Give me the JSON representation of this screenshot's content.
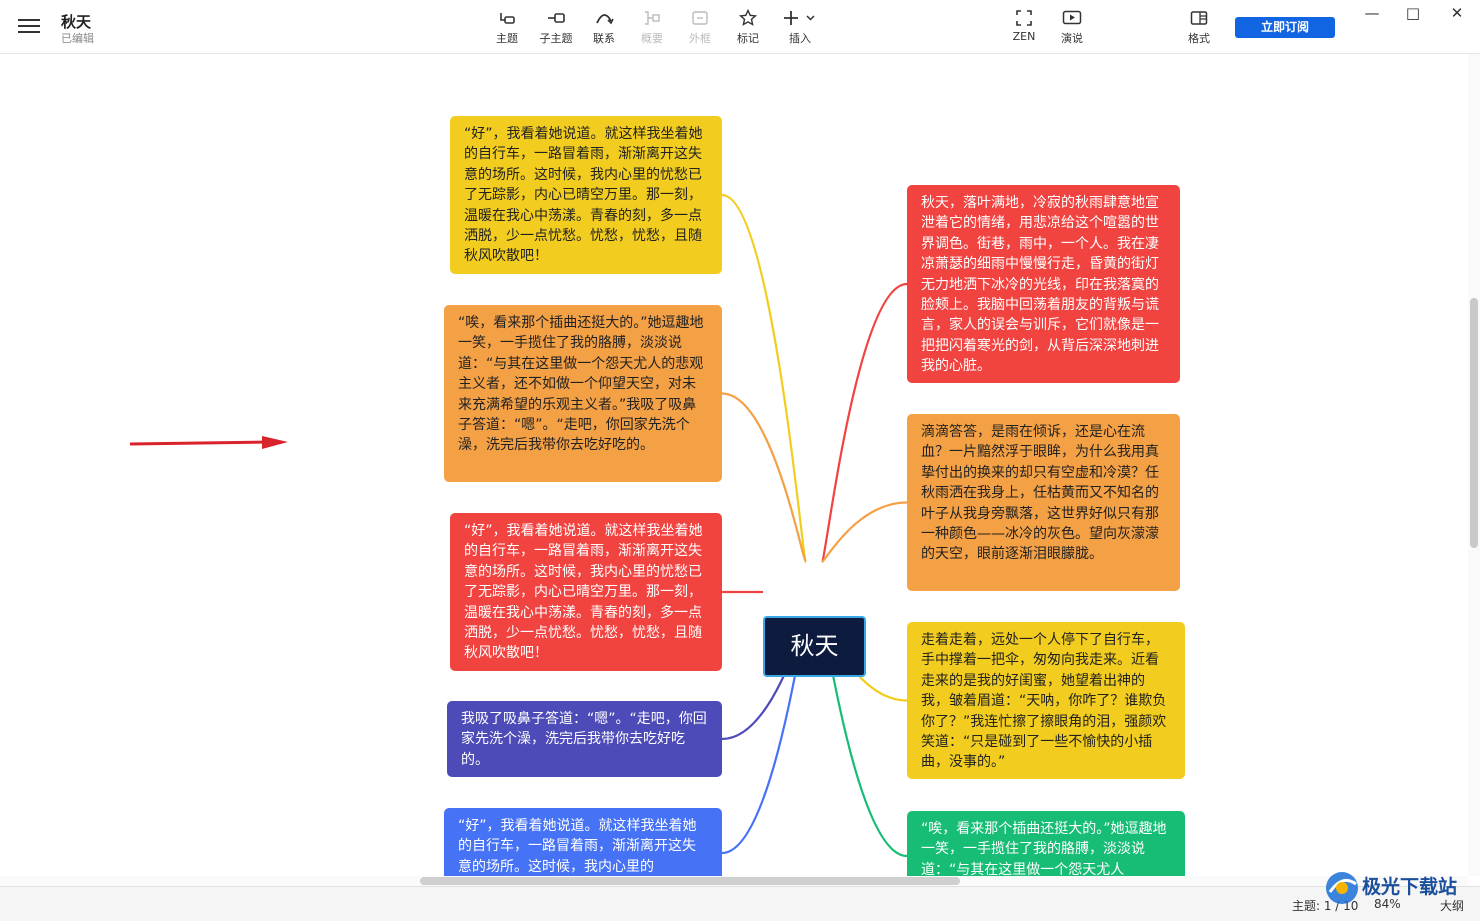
{
  "app": {
    "title": "秋天",
    "status": "已编辑"
  },
  "toolbar": {
    "topic": "主题",
    "subtopic": "子主题",
    "relation": "联系",
    "summary": "概要",
    "boundary": "外框",
    "marker": "标记",
    "insert": "插入",
    "zen": "ZEN",
    "present": "演说",
    "format": "格式",
    "subscribe": "立即订阅"
  },
  "colors": {
    "yellow": "#f2cd1f",
    "orange": "#f4a044",
    "red": "#f14340",
    "purple": "#4c4bb7",
    "blue": "#4672f5",
    "green": "#17bd75",
    "root_bg": "#0d1b3e",
    "root_border": "#39a6e6",
    "accent": "#1265e2"
  },
  "mindmap": {
    "root": "秋天",
    "left": [
      {
        "color": "yellow",
        "text": "“好”，我看着她说道。就这样我坐着她的自行车，一路冒着雨，渐渐离开这失意的场所。这时候，我内心里的忧愁已了无踪影，内心已晴空万里。那一刻，温暖在我心中荡漾。青春的刻，多一点洒脱，少一点忧愁。忧愁，忧愁，且随秋风吹散吧！"
      },
      {
        "color": "orange",
        "text": "“唉，看来那个插曲还挺大的。”她逗趣地一笑，一手揽住了我的胳膊，淡淡说道：“与其在这里做一个怨天尤人的悲观主义者，还不如做一个仰望天空，对未来充满希望的乐观主义者。”我吸了吸鼻子答道：“嗯”。“走吧，你回家先洗个澡，洗完后我带你去吃好吃的。"
      },
      {
        "color": "red",
        "text": "“好”，我看着她说道。就这样我坐着她的自行车，一路冒着雨，渐渐离开这失意的场所。这时候，我内心里的忧愁已了无踪影，内心已晴空万里。那一刻，温暖在我心中荡漾。青春的刻，多一点洒脱，少一点忧愁。忧愁，忧愁，且随秋风吹散吧！"
      },
      {
        "color": "purple",
        "text": "我吸了吸鼻子答道：“嗯”。“走吧，你回家先洗个澡，洗完后我带你去吃好吃的。"
      },
      {
        "color": "blue",
        "text": "“好”，我看着她说道。就这样我坐着她的自行车，一路冒着雨，渐渐离开这失意的场所。这时候，我内心里的"
      }
    ],
    "right": [
      {
        "color": "red",
        "text": "秋天，落叶满地，冷寂的秋雨肆意地宣泄着它的情绪，用悲凉给这个喧嚣的世界调色。街巷，雨中，一个人。我在凄凉萧瑟的细雨中慢慢行走，昏黄的街灯无力地洒下冰冷的光线，印在我落寞的脸颊上。我脑中回荡着朋友的背叛与谎言，家人的误会与训斥，它们就像是一把把闪着寒光的剑，从背后深深地刺进我的心脏。"
      },
      {
        "color": "orange",
        "text": "滴滴答答，是雨在倾诉，还是心在流血？一片黯然浮于眼眸，为什么我用真挚付出的换来的却只有空虚和冷漠？任秋雨洒在我身上，任枯黄而又不知名的叶子从我身旁飘落，这世界好似只有那一种颜色——冰冷的灰色。望向灰濛濛的天空，眼前逐渐泪眼朦胧。"
      },
      {
        "color": "yellow",
        "text": "走着走着，远处一个人停下了自行车，手中撑着一把伞，匆匆向我走来。近看走来的是我的好闺蜜，她望着出神的我，皱着眉道：“天呐，你咋了？谁欺负你了？”我连忙擦了擦眼角的泪，强颜欢笑道：“只是碰到了一些不愉快的小插曲，没事的。”"
      },
      {
        "color": "green",
        "text": "“唉，看来那个插曲还挺大的。”她逗趣地一笑，一手揽住了我的胳膊，淡淡说道：“与其在这里做一个怨天尤人"
      }
    ]
  },
  "status": {
    "topic_count": "主题: 1 / 10",
    "zoom": "84%",
    "outline": "大纲"
  },
  "watermark": "极光下载站"
}
